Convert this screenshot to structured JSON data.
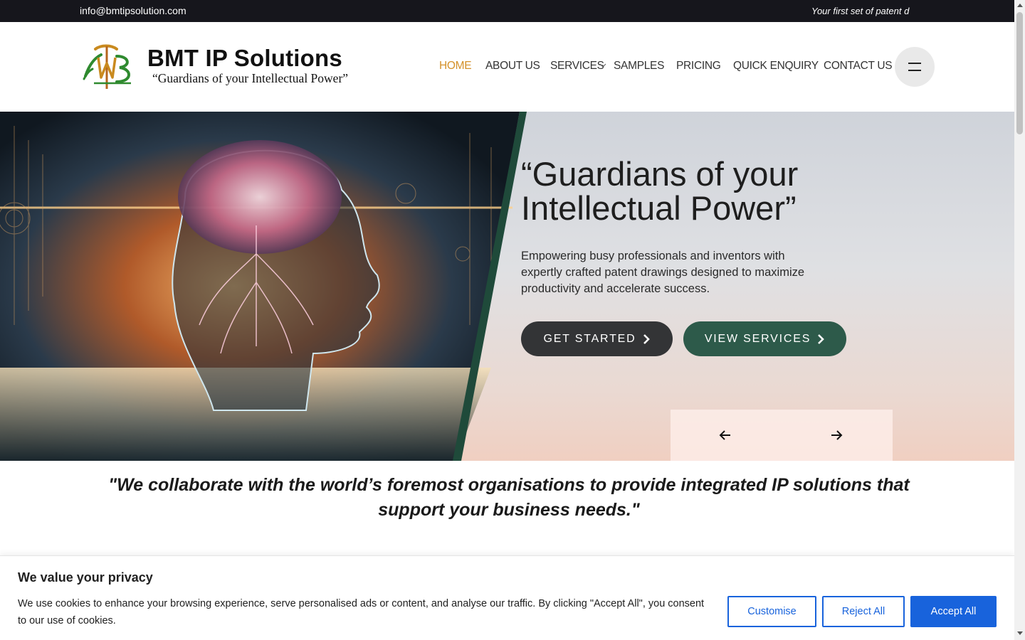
{
  "topbar": {
    "email": "info@bmtipsolution.com",
    "ticker": "Your first set of patent d"
  },
  "header": {
    "logo": {
      "brand": "BMT IP Solutions",
      "tagline": "“Guardians of your Intellectual Power”"
    },
    "nav": [
      {
        "label": "HOME",
        "active": true
      },
      {
        "label": "ABOUT US"
      },
      {
        "label": "SERVICES"
      },
      {
        "label": "SAMPLES"
      },
      {
        "label": "PRICING"
      },
      {
        "label": "QUICK ENQUIRY"
      },
      {
        "label": "CONTACT US"
      }
    ],
    "menu_icon": "hamburger-icon"
  },
  "hero": {
    "title_line1": "“Guardians of your",
    "title_line2": "Intellectual Power”",
    "description": "Empowering busy professionals and inventors with expertly crafted patent drawings designed to maximize productivity and accelerate success.",
    "primary_button": "GET STARTED",
    "secondary_button": "VIEW SERVICES",
    "prev_icon": "arrow-left-icon",
    "next_icon": "arrow-right-icon"
  },
  "quote": "\"We collaborate with the world’s foremost organisations to provide integrated IP solutions that support your business needs.\"",
  "cookie": {
    "title": "We value your privacy",
    "text": "We use cookies to enhance your browsing experience, serve personalised ads or content, and analyse our traffic. By clicking \"Accept All\", you consent to our use of cookies.",
    "customise": "Customise",
    "reject": "Reject All",
    "accept": "Accept All"
  },
  "colors": {
    "accent_nav": "#d4912a",
    "dark_button": "#333436",
    "green_button": "#2d5a4a",
    "cookie_blue": "#1863dc",
    "topbar": "#16161c"
  }
}
